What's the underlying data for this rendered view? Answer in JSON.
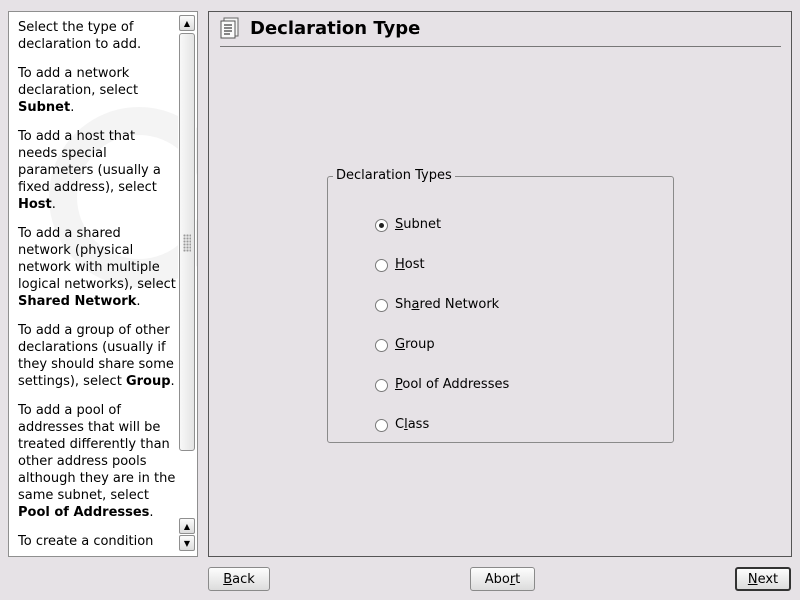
{
  "help": {
    "paragraphs": [
      {
        "text": "Select the type of declaration to add.",
        "bold": ""
      },
      {
        "text": "To add a network declaration, select ",
        "bold": "Subnet",
        "end": "."
      },
      {
        "text": "To add a host that needs special parameters (usually a fixed address), select ",
        "bold": "Host",
        "end": "."
      },
      {
        "text": "To add a shared network (physical network with multiple logical networks), select ",
        "bold": "Shared Network",
        "end": "."
      },
      {
        "text": "To add a group of other declarations (usually if they should share some settings), select ",
        "bold": "Group",
        "end": "."
      },
      {
        "text": "To add a pool of addresses that will be treated differently than other address pools although they are in the same subnet, select ",
        "bold": "Pool of Addresses",
        "end": "."
      },
      {
        "text": "To create a condition",
        "bold": ""
      }
    ]
  },
  "header": {
    "title": "Declaration Type"
  },
  "group": {
    "legend": "Declaration Types",
    "options": [
      {
        "pre": "",
        "key": "S",
        "post": "ubnet",
        "checked": true
      },
      {
        "pre": "",
        "key": "H",
        "post": "ost",
        "checked": false
      },
      {
        "pre": "Sh",
        "key": "a",
        "post": "red Network",
        "checked": false
      },
      {
        "pre": "",
        "key": "G",
        "post": "roup",
        "checked": false
      },
      {
        "pre": "",
        "key": "P",
        "post": "ool of Addresses",
        "checked": false
      },
      {
        "pre": "C",
        "key": "l",
        "post": "ass",
        "checked": false
      }
    ]
  },
  "buttons": {
    "back": {
      "pre": "",
      "key": "B",
      "post": "ack"
    },
    "abort": {
      "pre": "Abo",
      "key": "r",
      "post": "t"
    },
    "next": {
      "pre": "",
      "key": "N",
      "post": "ext"
    }
  }
}
